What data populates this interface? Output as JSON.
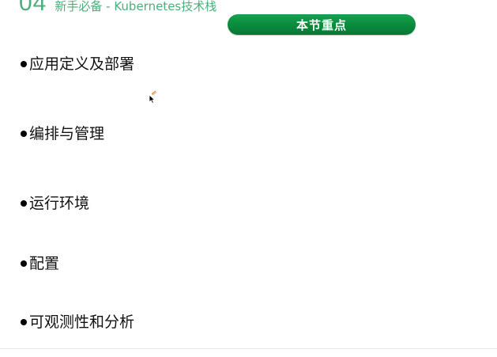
{
  "header": {
    "number": "04",
    "title": "新手必备 - Kubernetes技术栈"
  },
  "section_badge": {
    "label": "本节重点"
  },
  "bullets": [
    {
      "text": "应用定义及部署"
    },
    {
      "text": "编排与管理"
    },
    {
      "text": "运行环境"
    },
    {
      "text": "配置"
    },
    {
      "text": "可观测性和分析"
    }
  ],
  "colors": {
    "accent_green": "#0a8a3c",
    "header_green": "#4cae7b",
    "text": "#111111",
    "background": "#ffffff"
  },
  "icons": {
    "cursor": "mouse-pointer-icon",
    "bullet": "bullet-dot-icon"
  }
}
